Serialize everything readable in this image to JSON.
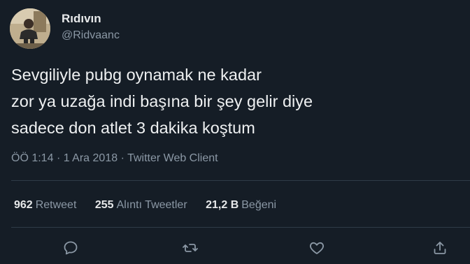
{
  "author": {
    "display_name": "Rıdıvın",
    "handle": "@Ridvaanc"
  },
  "tweet": {
    "lines": [
      "Sevgiliyle pubg oynamak ne kadar",
      "zor ya uzağa indi başına bir şey gelir diye",
      "sadece don atlet 3 dakika koştum"
    ]
  },
  "meta": {
    "time": "ÖÖ 1:14",
    "date": "1 Ara 2018",
    "client": "Twitter Web Client",
    "separator": "·"
  },
  "stats": {
    "retweets": {
      "count": "962",
      "label": "Retweet"
    },
    "quotes": {
      "count": "255",
      "label": "Alıntı Tweetler"
    },
    "likes": {
      "count": "21,2 B",
      "label": "Beğeni"
    }
  },
  "actions": [
    {
      "name": "reply",
      "icon": "reply-icon"
    },
    {
      "name": "retweet",
      "icon": "retweet-icon"
    },
    {
      "name": "like",
      "icon": "heart-icon"
    },
    {
      "name": "share",
      "icon": "share-icon"
    }
  ],
  "colors": {
    "background": "#151d26",
    "text": "#e7e9ea",
    "muted": "#8b98a5",
    "divider": "#2f3b47"
  }
}
